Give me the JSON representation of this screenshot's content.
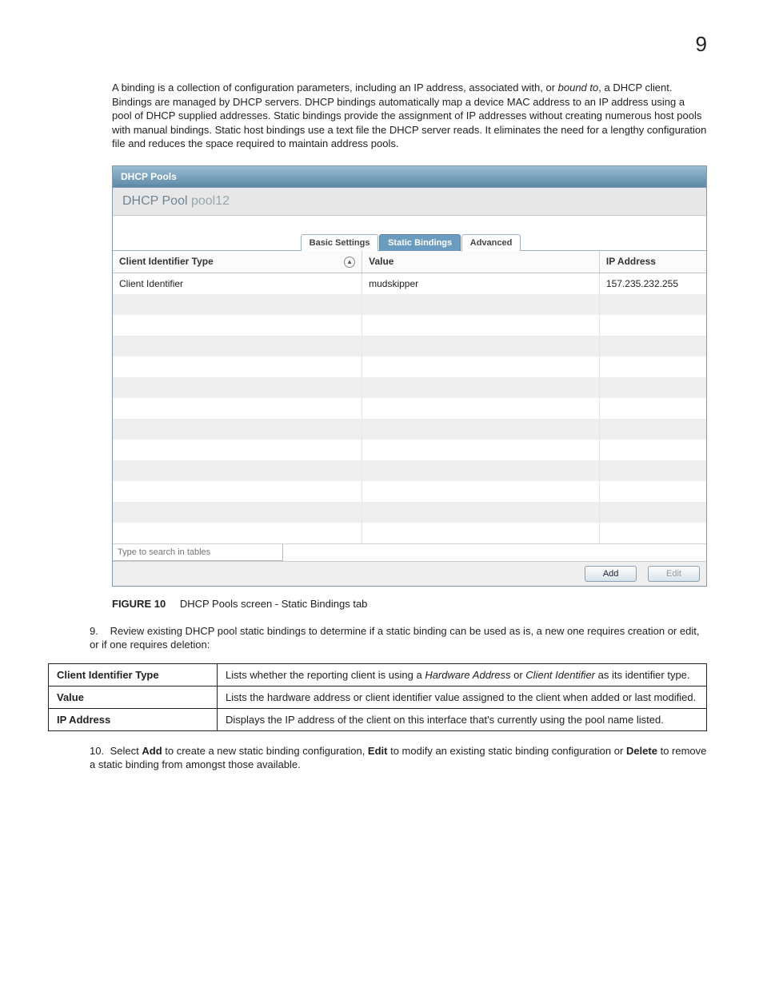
{
  "pageNumber": "9",
  "intro": "A binding is a collection of configuration parameters, including an IP address, associated with, or bound to, a DHCP client. Bindings are managed by DHCP servers. DHCP bindings automatically map a device MAC address to an IP address using a pool of DHCP supplied addresses. Static bindings provide the assignment of IP addresses without creating numerous host pools with manual bindings. Static host bindings use a text file the DHCP server reads. It eliminates the need for a lengthy configuration file and reduces the space required to maintain address pools.",
  "panel": {
    "header": "DHCP Pools",
    "poolLabel": "DHCP Pool",
    "poolName": "pool12",
    "tabs": {
      "basic": "Basic Settings",
      "static": "Static Bindings",
      "advanced": "Advanced"
    },
    "columns": {
      "clientIdType": "Client Identifier Type",
      "value": "Value",
      "ipAddress": "IP Address"
    },
    "rows": [
      {
        "clientIdType": "Client Identifier",
        "value": "mudskipper",
        "ipAddress": "157.235.232.255"
      }
    ],
    "blankRows": 12,
    "searchPlaceholder": "Type to search in tables",
    "buttons": {
      "add": "Add",
      "edit": "Edit"
    }
  },
  "figure": {
    "label": "FIGURE 10",
    "caption": "DHCP Pools screen - Static Bindings tab"
  },
  "step9": {
    "num": "9.",
    "text": "Review existing DHCP pool static bindings to determine if a static binding can be used as is, a new one requires creation or edit, or if one requires deletion:"
  },
  "descTable": [
    {
      "term": "Client Identifier Type",
      "desc_pre": "Lists whether the reporting client is using a ",
      "desc_em1": "Hardware Address",
      "desc_mid": " or ",
      "desc_em2": "Client Identifier",
      "desc_post": " as its identifier type."
    },
    {
      "term": "Value",
      "desc": "Lists the hardware address or client identifier value assigned to the client when added or last modified."
    },
    {
      "term": "IP Address",
      "desc": "Displays the IP address of the client on this interface that's currently using the pool name listed."
    }
  ],
  "step10": {
    "num": "10.",
    "pre": "Select ",
    "b1": "Add",
    "mid1": " to create a new static binding configuration, ",
    "b2": "Edit",
    "mid2": " to modify an existing static binding configuration or ",
    "b3": "Delete",
    "post": " to remove a static binding from amongst those available."
  }
}
